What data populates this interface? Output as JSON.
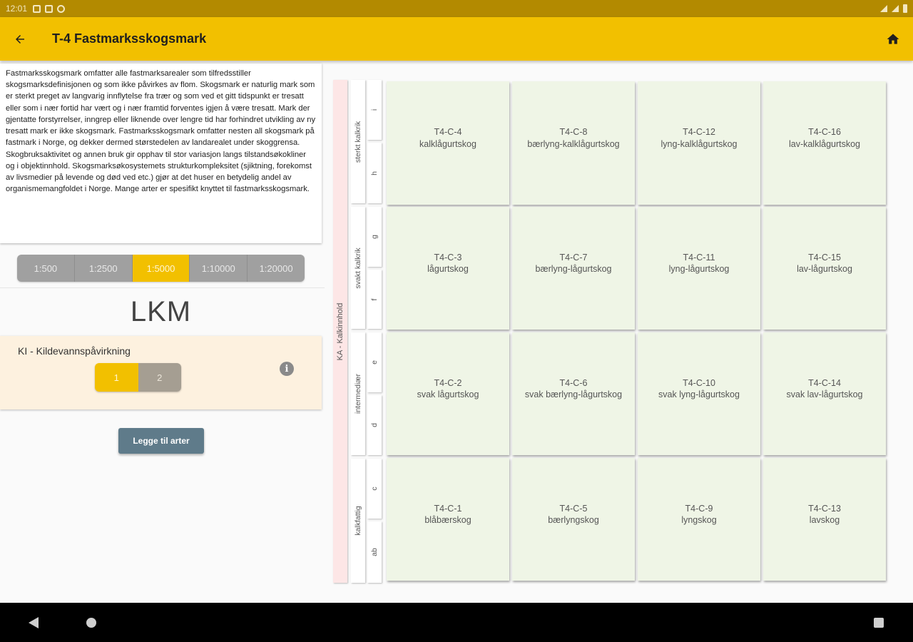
{
  "status_bar": {
    "time": "12:01"
  },
  "app_bar": {
    "title": "T-4 Fastmarksskogsmark"
  },
  "description": "Fastmarksskogsmark omfatter alle fastmarksarealer som tilfredsstiller skogsmarksdefinisjonen og som ikke påvirkes av flom. Skogsmark er naturlig mark som er sterkt preget av langvarig innflytelse fra trær og som ved et gitt tidspunkt er tresatt eller som i nær fortid har vært og i nær framtid forventes igjen å være tresatt. Mark der gjentatte forstyrrelser, inngrep eller liknende over lengre tid har forhindret utvikling av ny tresatt mark er ikke skogsmark. Fastmarksskogsmark omfatter nesten all skogsmark på fastmark i Norge, og dekker dermed størstedelen av landarealet under skoggrensa. Skogbruksaktivitet og annen bruk gir opphav til stor variasjon langs tilstandsøkokliner og i objektinnhold. Skogsmarksøkosystemets strukturkompleksitet (sjiktning, forekomst av livsmedier på levende og død ved etc.) gjør at det huser en betydelig andel av organismemangfoldet i Norge. Mange arter er spesifikt knyttet til fastmarksskogsmark.",
  "scales": [
    {
      "label": "1:500",
      "active": false
    },
    {
      "label": "1:2500",
      "active": false
    },
    {
      "label": "1:5000",
      "active": true
    },
    {
      "label": "1:10000",
      "active": false
    },
    {
      "label": "1:20000",
      "active": false
    }
  ],
  "lkm_title": "LKM",
  "ki": {
    "label": "KI - Kildevannspåvirkning",
    "options": [
      {
        "label": "1",
        "active": true
      },
      {
        "label": "2",
        "active": false
      }
    ],
    "info_icon": "i"
  },
  "add_button": "Legge til arter",
  "grid": {
    "axis_label": "KA - Kalkinnhold",
    "groups": [
      "sterkt kalkrik",
      "svakt kalkrik",
      "intermediær",
      "kalkfattig"
    ],
    "steps": [
      "i",
      "h",
      "g",
      "f",
      "e",
      "d",
      "c",
      "ab"
    ],
    "rows": [
      [
        {
          "code": "T4-C-4",
          "name": "kalklågurtskog"
        },
        {
          "code": "T4-C-8",
          "name": "bærlyng-kalklågurtskog"
        },
        {
          "code": "T4-C-12",
          "name": "lyng-kalklågurtskog"
        },
        {
          "code": "T4-C-16",
          "name": "lav-kalklågurtskog"
        }
      ],
      [
        {
          "code": "T4-C-3",
          "name": "lågurtskog"
        },
        {
          "code": "T4-C-7",
          "name": "bærlyng-lågurtskog"
        },
        {
          "code": "T4-C-11",
          "name": "lyng-lågurtskog"
        },
        {
          "code": "T4-C-15",
          "name": "lav-lågurtskog"
        }
      ],
      [
        {
          "code": "T4-C-2",
          "name": "svak lågurtskog"
        },
        {
          "code": "T4-C-6",
          "name": "svak bærlyng-lågurtskog"
        },
        {
          "code": "T4-C-10",
          "name": "svak lyng-lågurtskog"
        },
        {
          "code": "T4-C-14",
          "name": "svak lav-lågurtskog"
        }
      ],
      [
        {
          "code": "T4-C-1",
          "name": "blåbærskog"
        },
        {
          "code": "T4-C-5",
          "name": "bærlyngskog"
        },
        {
          "code": "T4-C-9",
          "name": "lyngskog"
        },
        {
          "code": "T4-C-13",
          "name": "lavskog"
        }
      ]
    ]
  },
  "colors": {
    "primary": "#f2c000",
    "status_bar": "#b38a00",
    "cell_bg": "#eff5e6",
    "ki_bg": "#fdf1df",
    "axis_bg": "#fde6e6",
    "add_button": "#5f7b8a"
  }
}
